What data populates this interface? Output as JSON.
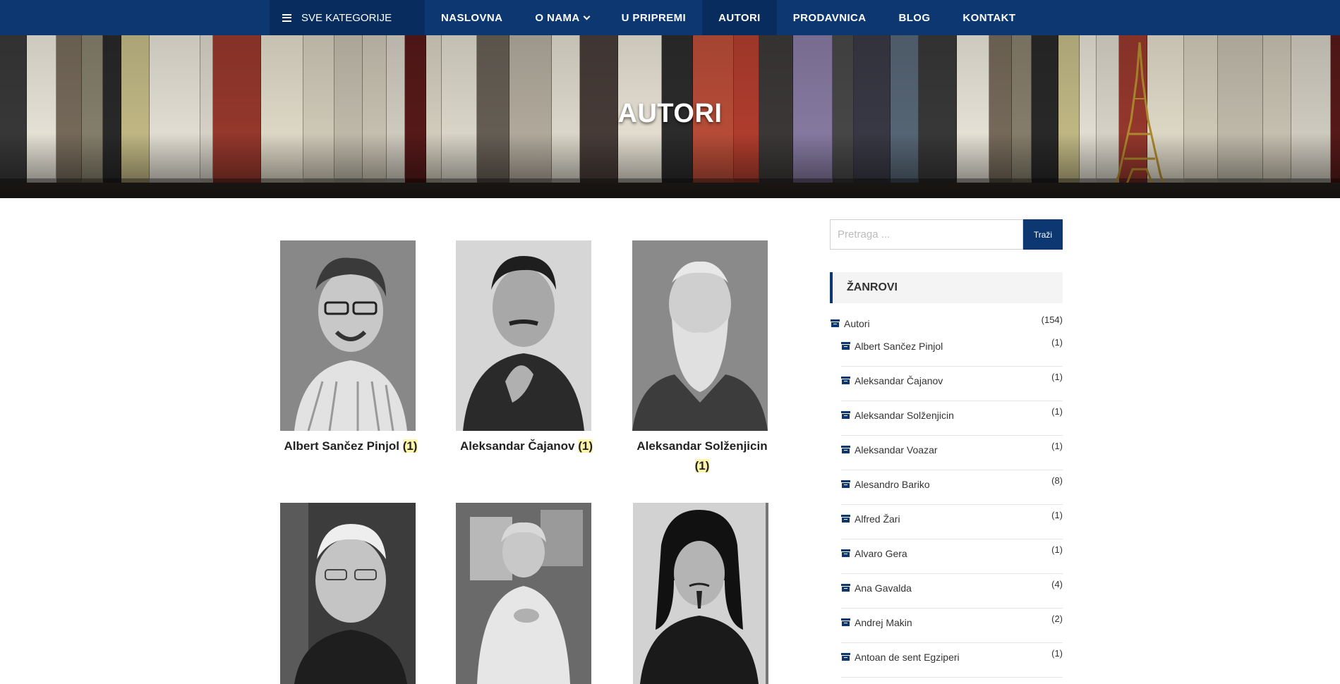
{
  "nav": {
    "category_button": "SVE KATEGORIJE",
    "items": [
      {
        "label": "NASLOVNA"
      },
      {
        "label": "O NAMA"
      },
      {
        "label": "U PRIPREMI"
      },
      {
        "label": "AUTORI"
      },
      {
        "label": "PRODAVNICA"
      },
      {
        "label": "BLOG"
      },
      {
        "label": "KONTAKT"
      }
    ]
  },
  "hero": {
    "title": "AUTORI"
  },
  "authors": [
    {
      "name": "Albert Sančez Pinjol",
      "count": "(1)"
    },
    {
      "name": "Aleksandar Čajanov",
      "count": "(1)"
    },
    {
      "name": "Aleksandar Solženjicin",
      "count": "(1)"
    },
    {
      "name": "",
      "count": ""
    },
    {
      "name": "",
      "count": ""
    },
    {
      "name": "",
      "count": ""
    }
  ],
  "sidebar": {
    "search": {
      "placeholder": "Pretraga ...",
      "button": "Traži"
    },
    "widget_title": "ŽANROVI",
    "root": {
      "label": "Autori",
      "count": "(154)"
    },
    "categories": [
      {
        "label": "Albert Sančez Pinjol",
        "count": "(1)"
      },
      {
        "label": "Aleksandar Čajanov",
        "count": "(1)"
      },
      {
        "label": "Aleksandar Solženjicin",
        "count": "(1)"
      },
      {
        "label": "Aleksandar Voazar",
        "count": "(1)"
      },
      {
        "label": "Alesandro Bariko",
        "count": "(8)"
      },
      {
        "label": "Alfred Žari",
        "count": "(1)"
      },
      {
        "label": "Alvaro Gera",
        "count": "(1)"
      },
      {
        "label": "Ana Gavalda",
        "count": "(4)"
      },
      {
        "label": "Andrej Makin",
        "count": "(2)"
      },
      {
        "label": "Antoan de sent Egziperi",
        "count": "(1)"
      }
    ]
  },
  "colors": {
    "brand": "#0c3770",
    "brand_dark": "#082c5e",
    "count_highlight": "#fff5a8"
  }
}
